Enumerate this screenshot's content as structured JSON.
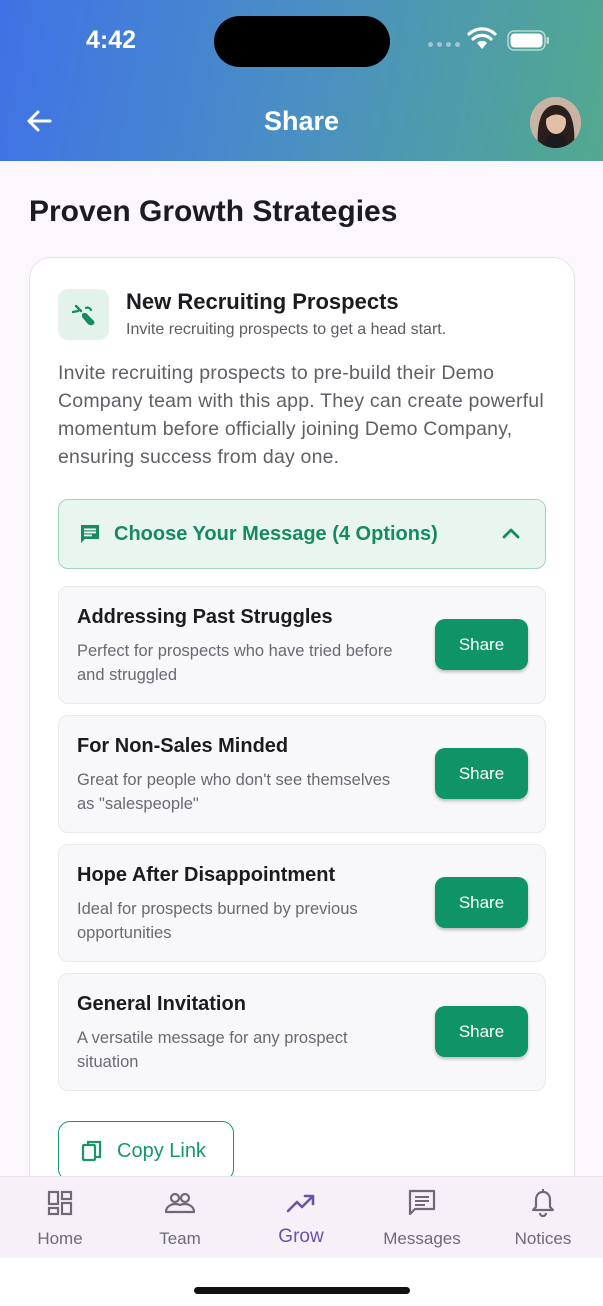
{
  "status_bar": {
    "time": "4:42"
  },
  "header": {
    "title": "Share"
  },
  "page": {
    "title": "Proven Growth Strategies"
  },
  "card": {
    "title": "New Recruiting Prospects",
    "subtitle": "Invite recruiting prospects to get a head start.",
    "description": "Invite recruiting prospects to pre-build their Demo Company team with this app. They can create powerful momentum before officially joining Demo Company, ensuring success from day one.",
    "chooser_label": "Choose Your Message (4 Options)",
    "options": [
      {
        "title": "Addressing Past Struggles",
        "description": "Perfect for prospects who have tried before and struggled",
        "button": "Share"
      },
      {
        "title": "For Non-Sales Minded",
        "description": "Great for people who don't see themselves as \"salespeople\"",
        "button": "Share"
      },
      {
        "title": "Hope After Disappointment",
        "description": "Ideal for prospects burned by previous opportunities",
        "button": "Share"
      },
      {
        "title": "General Invitation",
        "description": "A versatile message for any prospect situation",
        "button": "Share"
      }
    ],
    "copy_link_label": "Copy Link"
  },
  "bottom_nav": {
    "items": [
      {
        "label": "Home",
        "icon": "dashboard-icon"
      },
      {
        "label": "Team",
        "icon": "team-icon"
      },
      {
        "label": "Grow",
        "icon": "trending-up-icon",
        "active": true
      },
      {
        "label": "Messages",
        "icon": "message-icon"
      },
      {
        "label": "Notices",
        "icon": "bell-icon"
      }
    ]
  },
  "colors": {
    "accent_green": "#0f9467",
    "active_nav": "#6753a8",
    "header_start": "#3f72e6",
    "header_end": "#52a98e"
  }
}
